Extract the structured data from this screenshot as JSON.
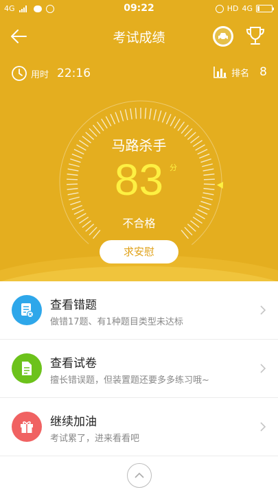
{
  "status_bar": {
    "network": "4G",
    "time": "09:22",
    "hd_label": "HD",
    "network_right": "4G"
  },
  "header": {
    "title": "考试成绩",
    "back_icon": "arrow-left-icon",
    "car_icon": "car-icon",
    "trophy_icon": "trophy-icon"
  },
  "stats": {
    "time_label": "用时",
    "time_value": "22:16",
    "rank_label": "排名",
    "rank_value": "8"
  },
  "gauge": {
    "title": "马路杀手",
    "score": "83",
    "score_unit": "分",
    "result": "不合格",
    "score_fraction": 0.83
  },
  "comfort_button": "求安慰",
  "list": [
    {
      "title": "查看错题",
      "subtitle": "做错17题、有1种题目类型未达标",
      "icon": "wrong-questions-icon",
      "color": "#2ea7ea"
    },
    {
      "title": "查看试卷",
      "subtitle": "擅长错误题，但装置题还要多多练习哦~",
      "icon": "paper-icon",
      "color": "#6cc21b"
    },
    {
      "title": "继续加油",
      "subtitle": "考试累了，进来看看吧",
      "icon": "gift-icon",
      "color": "#f06262"
    }
  ],
  "colors": {
    "hero_bg": "#e4ae1f",
    "score": "#fdf042",
    "button_text": "#e0a21a"
  }
}
